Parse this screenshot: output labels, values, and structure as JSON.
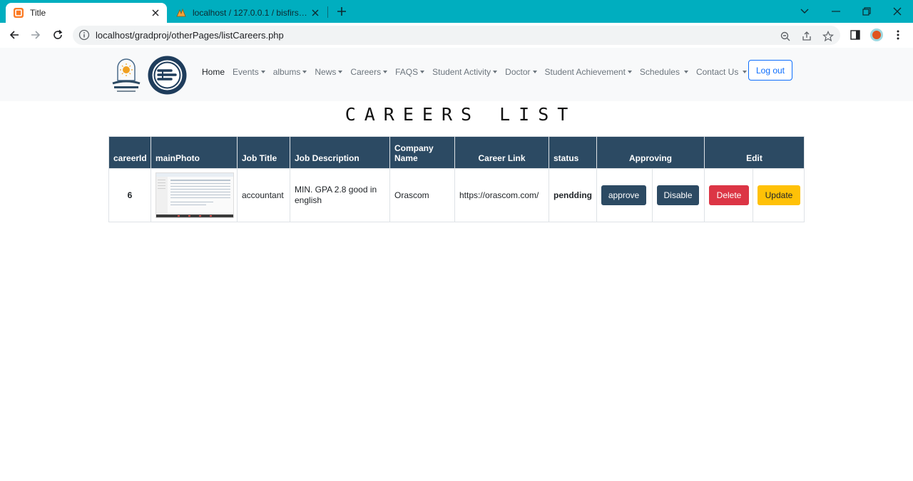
{
  "browser": {
    "tabs": [
      {
        "title": "Title",
        "active": true
      },
      {
        "title": "localhost / 127.0.0.1 / bisfirstweb",
        "active": false
      }
    ],
    "url": "localhost/gradproj/otherPages/listCareers.php",
    "accent_color": "#00aebf"
  },
  "nav": {
    "items": [
      {
        "label": "Home",
        "dropdown": false
      },
      {
        "label": "Events",
        "dropdown": true
      },
      {
        "label": "albums",
        "dropdown": true
      },
      {
        "label": "News",
        "dropdown": true
      },
      {
        "label": "Careers",
        "dropdown": true
      },
      {
        "label": "FAQS",
        "dropdown": true
      },
      {
        "label": "Student Activity",
        "dropdown": true
      },
      {
        "label": "Doctor",
        "dropdown": true
      },
      {
        "label": "Student Achievement",
        "dropdown": true
      },
      {
        "label": "Schedules",
        "dropdown": true
      },
      {
        "label": "Contact Us",
        "dropdown": true
      }
    ],
    "logout_label": "Log out"
  },
  "page": {
    "title": "CAREERS LIST"
  },
  "table": {
    "header_color": "#2c4a63",
    "columns": [
      "careerId",
      "mainPhoto",
      "Job Title",
      "Job Description",
      "Company Name",
      "Career Link",
      "status",
      "Approving",
      "Edit"
    ],
    "rows": [
      {
        "careerId": "6",
        "job_title": "accountant",
        "job_description": "MIN. GPA 2.8 good in english",
        "company_name": "Orascom",
        "career_link": "https://orascom.com/",
        "status": "pendding",
        "approve_label": "approve",
        "disable_label": "Disable",
        "delete_label": "Delete",
        "update_label": "Update"
      }
    ]
  }
}
